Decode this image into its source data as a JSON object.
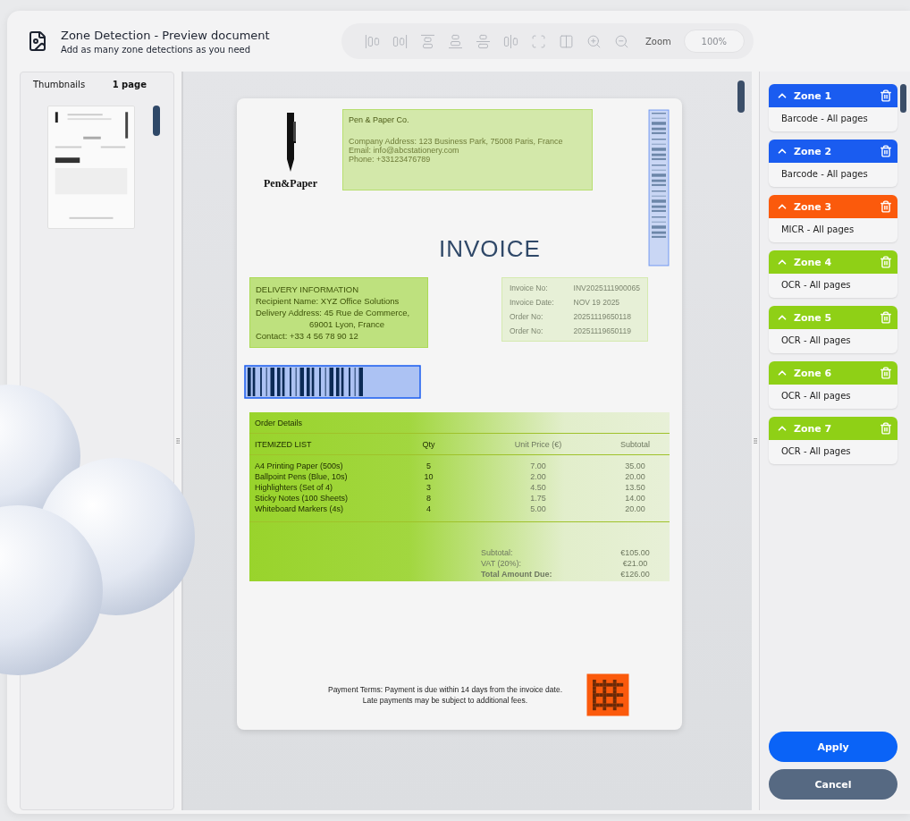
{
  "header": {
    "title": "Zone Detection - Preview document",
    "subtitle": "Add as many zone detections as you need"
  },
  "toolbar": {
    "tools": [
      {
        "kind": "align-left"
      },
      {
        "kind": "align-right"
      },
      {
        "kind": "align-top"
      },
      {
        "kind": "align-bottom"
      },
      {
        "kind": "center-vertical"
      },
      {
        "kind": "center-horizontal"
      },
      {
        "kind": "fit-page"
      },
      {
        "kind": "fit-width"
      },
      {
        "kind": "zoom-in"
      },
      {
        "kind": "zoom-out"
      }
    ],
    "zoom_label": "Zoom",
    "zoom_value": "100%"
  },
  "thumbnails": {
    "title": "Thumbnails",
    "count": "1 page"
  },
  "document": {
    "logo_text": "Pen&Paper",
    "company": {
      "name": "Pen & Paper Co.",
      "lines": [
        "Company Address: 123 Business Park, 75008 Paris, France",
        "Email: info@abcstationery.com",
        "Phone: +33123476789"
      ]
    },
    "title": "INVOICE",
    "delivery": {
      "lines": [
        "DELIVERY INFORMATION",
        "Recipient Name: XYZ Office Solutions",
        "Delivery Address: 45 Rue de Commerce,",
        "69001 Lyon, France",
        "Contact: +33 4 56 78 90 12"
      ]
    },
    "invoice_info": {
      "rows": [
        {
          "label": "Invoice No:",
          "value": "INV2025111900065"
        },
        {
          "label": "Invoice Date:",
          "value": "NOV 19 2025"
        },
        {
          "label": "Order No:",
          "value": "20251119650118"
        },
        {
          "label": "Order No:",
          "value": "20251119650119"
        }
      ]
    },
    "table": {
      "section": "Order Details",
      "columns": [
        "ITEMIZED LIST",
        "Qty",
        "Unit Price (€)",
        "Subtotal"
      ],
      "rows": [
        [
          "A4 Printing Paper (500s)",
          "5",
          "7.00",
          "35.00"
        ],
        [
          "Ballpoint Pens (Blue, 10s)",
          "10",
          "2.00",
          "20.00"
        ],
        [
          "Highlighters (Set of 4)",
          "3",
          "4.50",
          "13.50"
        ],
        [
          "Sticky Notes (100 Sheets)",
          "8",
          "1.75",
          "14.00"
        ],
        [
          "Whiteboard Markers (4s)",
          "4",
          "5.00",
          "20.00"
        ]
      ],
      "totals": [
        {
          "label": "Subtotal:",
          "value": "€105.00"
        },
        {
          "label": "VAT (20%):",
          "value": "€21.00"
        },
        {
          "label": "Total Amount Due:",
          "value": "€126.00"
        }
      ]
    },
    "terms": [
      "Payment Terms: Payment is due within 14 days from the invoice date.",
      "Late payments may be subject to additional fees."
    ]
  },
  "zones": [
    {
      "label": "Zone 1",
      "type": "Barcode - All pages",
      "color": "#1a5cf0",
      "expanded": true
    },
    {
      "label": "Zone 2",
      "type": "Barcode - All pages",
      "color": "#1a5cf0",
      "expanded": true
    },
    {
      "label": "Zone 3",
      "type": "MICR - All pages",
      "color": "#fb5a0c",
      "expanded": true
    },
    {
      "label": "Zone 4",
      "type": "OCR - All pages",
      "color": "#8fd016",
      "expanded": true
    },
    {
      "label": "Zone 5",
      "type": "OCR - All pages",
      "color": "#8fd016",
      "expanded": true
    },
    {
      "label": "Zone 6",
      "type": "OCR - All pages",
      "color": "#8fd016",
      "expanded": true
    },
    {
      "label": "Zone 7",
      "type": "OCR - All pages",
      "color": "#8fd016",
      "expanded": true
    }
  ],
  "buttons": [
    {
      "label": "Apply",
      "kind": "primary"
    },
    {
      "label": "Cancel",
      "kind": "secondary"
    }
  ]
}
